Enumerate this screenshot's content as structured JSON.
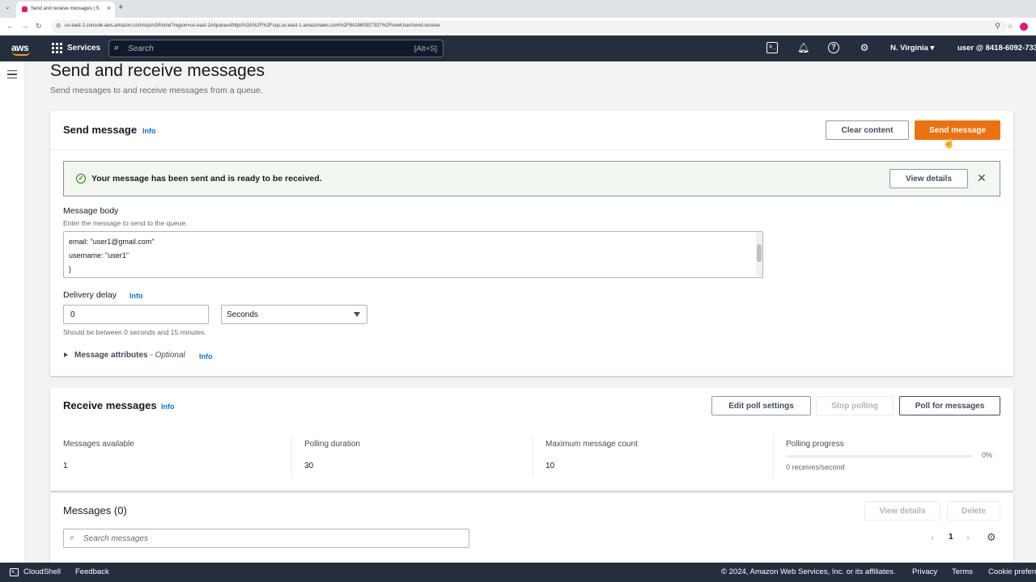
{
  "browser": {
    "tab_title": "Send and receive messages | S",
    "url": "us-east-1.console.aws.amazon.com/sqs/v3/home?region=us-east-1#/queues/https%3A%2F%2Fsqs.us-east-1.amazonaws.com%2F841860927337%2FnewUser/send-receive"
  },
  "header": {
    "logo": "aws",
    "services_label": "Services",
    "search_placeholder": "Search",
    "search_shortcut": "[Alt+S]",
    "region": "N. Virginia ▾",
    "user": "user @ 8418-6092-733"
  },
  "page": {
    "title": "Send and receive messages",
    "subtitle": "Send messages to and receive messages from a queue."
  },
  "send": {
    "title": "Send message",
    "info": "Info",
    "clear_label": "Clear content",
    "send_label": "Send message",
    "flash_message": "Your message has been sent and is ready to be received.",
    "view_details_label": "View details",
    "body_label": "Message body",
    "body_desc": "Enter the message to send to the queue.",
    "body_value": "email: \"user1@gmail.com\"\nusername: \"user1\"\n}",
    "delay_label": "Delivery delay",
    "delay_value": "0",
    "delay_unit": "Seconds",
    "delay_desc": "Should be between 0 seconds and 15 minutes.",
    "attributes_label": "Message attributes",
    "attributes_optional": " - Optional"
  },
  "receive": {
    "title": "Receive messages",
    "edit_poll_label": "Edit poll settings",
    "stop_polling_label": "Stop polling",
    "poll_label": "Poll for messages",
    "stats": [
      {
        "key": "Messages available",
        "value": "1"
      },
      {
        "key": "Polling duration",
        "value": "30"
      },
      {
        "key": "Maximum message count",
        "value": "10"
      }
    ],
    "progress_label": "Polling progress",
    "progress_pct": "0%",
    "progress_fraction": 0,
    "progress_rate": "0 receives/second"
  },
  "messages": {
    "title": "Messages (0)",
    "view_details_label": "View details",
    "delete_label": "Delete",
    "search_placeholder": "Search messages",
    "page": "1"
  },
  "footer": {
    "cloudshell": "CloudShell",
    "feedback": "Feedback",
    "copyright": "© 2024, Amazon Web Services, Inc. or its affiliates.",
    "privacy": "Privacy",
    "terms": "Terms",
    "cookies": "Cookie preferences"
  },
  "colors": {
    "accent": "#ec7211",
    "header_bg": "#232f3e",
    "link": "#0972d3",
    "success": "#1d8102"
  }
}
